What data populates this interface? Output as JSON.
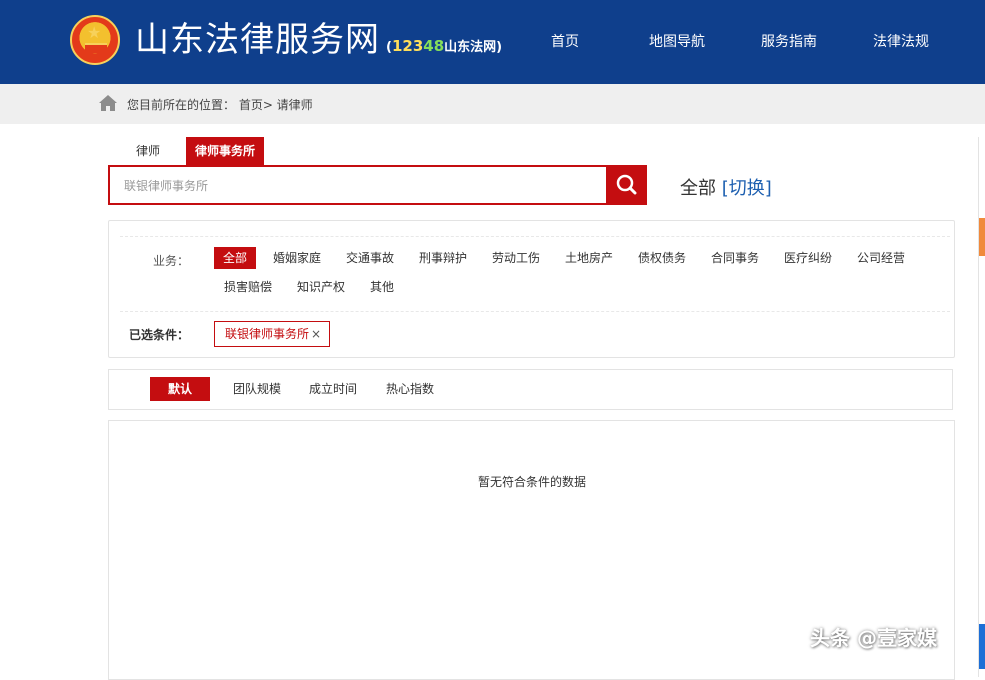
{
  "header": {
    "title": "山东法律服务网",
    "subtitle_open": "(",
    "subtitle_num1": "123",
    "subtitle_num2": "48",
    "subtitle_text": "山东法网",
    "subtitle_close": ")",
    "nav": [
      "首页",
      "地图导航",
      "服务指南",
      "法律法规"
    ]
  },
  "breadcrumb": {
    "text": "您目前所在的位置：  首页>  请律师"
  },
  "tabs": {
    "lawyer": "律师",
    "firm": "律师事务所"
  },
  "search": {
    "value": "联银律师事务所"
  },
  "region": {
    "label": "全部",
    "switch": "[切换]"
  },
  "filters": {
    "business_label": "业务：",
    "items": [
      "全部",
      "婚姻家庭",
      "交通事故",
      "刑事辩护",
      "劳动工伤",
      "土地房产",
      "债权债务",
      "合同事务",
      "医疗纠纷",
      "公司经营",
      "损害赔偿",
      "知识产权",
      "其他"
    ],
    "selected_label": "已选条件：",
    "selected_tag": "联银律师事务所",
    "selected_remove": "×"
  },
  "sort": {
    "items": [
      "默认",
      "团队规模",
      "成立时间",
      "热心指数"
    ]
  },
  "results": {
    "empty": "暂无符合条件的数据"
  },
  "watermark": "头条 @壹家媒",
  "colors": {
    "header_bg": "#0f3f8c",
    "accent": "#c40d10",
    "link": "#1d5fb0"
  }
}
